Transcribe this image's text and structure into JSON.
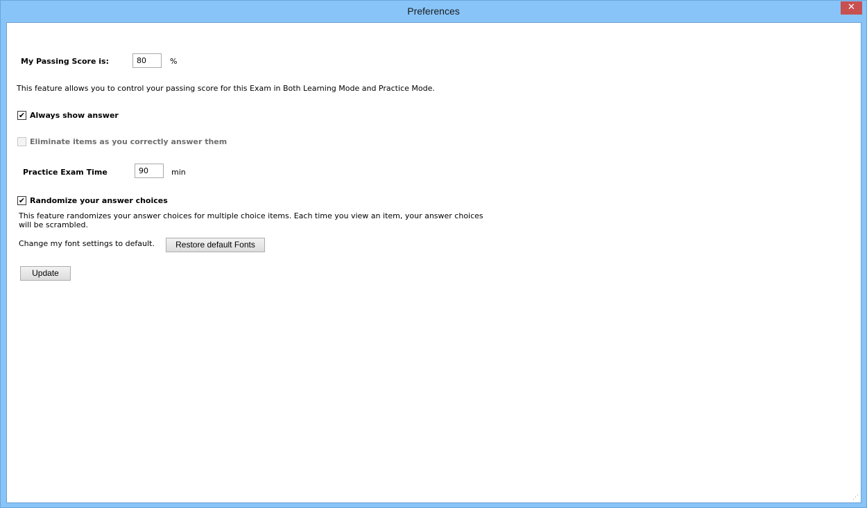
{
  "window": {
    "title": "Preferences",
    "close_glyph": "✕"
  },
  "passing_score": {
    "label": "My Passing Score is:",
    "value": "80",
    "unit": "%",
    "description": "This feature allows you to control your passing score for this Exam in Both Learning Mode and Practice Mode."
  },
  "always_show_answer": {
    "label": "Always show answer",
    "checked": true,
    "check_glyph": "✔"
  },
  "eliminate_items": {
    "label": "Eliminate items as you correctly answer them",
    "checked": false,
    "enabled": false
  },
  "practice_exam_time": {
    "label": "Practice Exam Time",
    "value": "90",
    "unit": "min"
  },
  "randomize": {
    "label": "Randomize your answer choices",
    "checked": true,
    "check_glyph": "✔",
    "description_line1": "This feature randomizes your answer choices for multiple choice items. Each time you view an item, your answer choices",
    "description_line2": "will be scrambled."
  },
  "fonts": {
    "label": "Change my font settings to default.",
    "button_label": "Restore default Fonts"
  },
  "update_button_label": "Update"
}
